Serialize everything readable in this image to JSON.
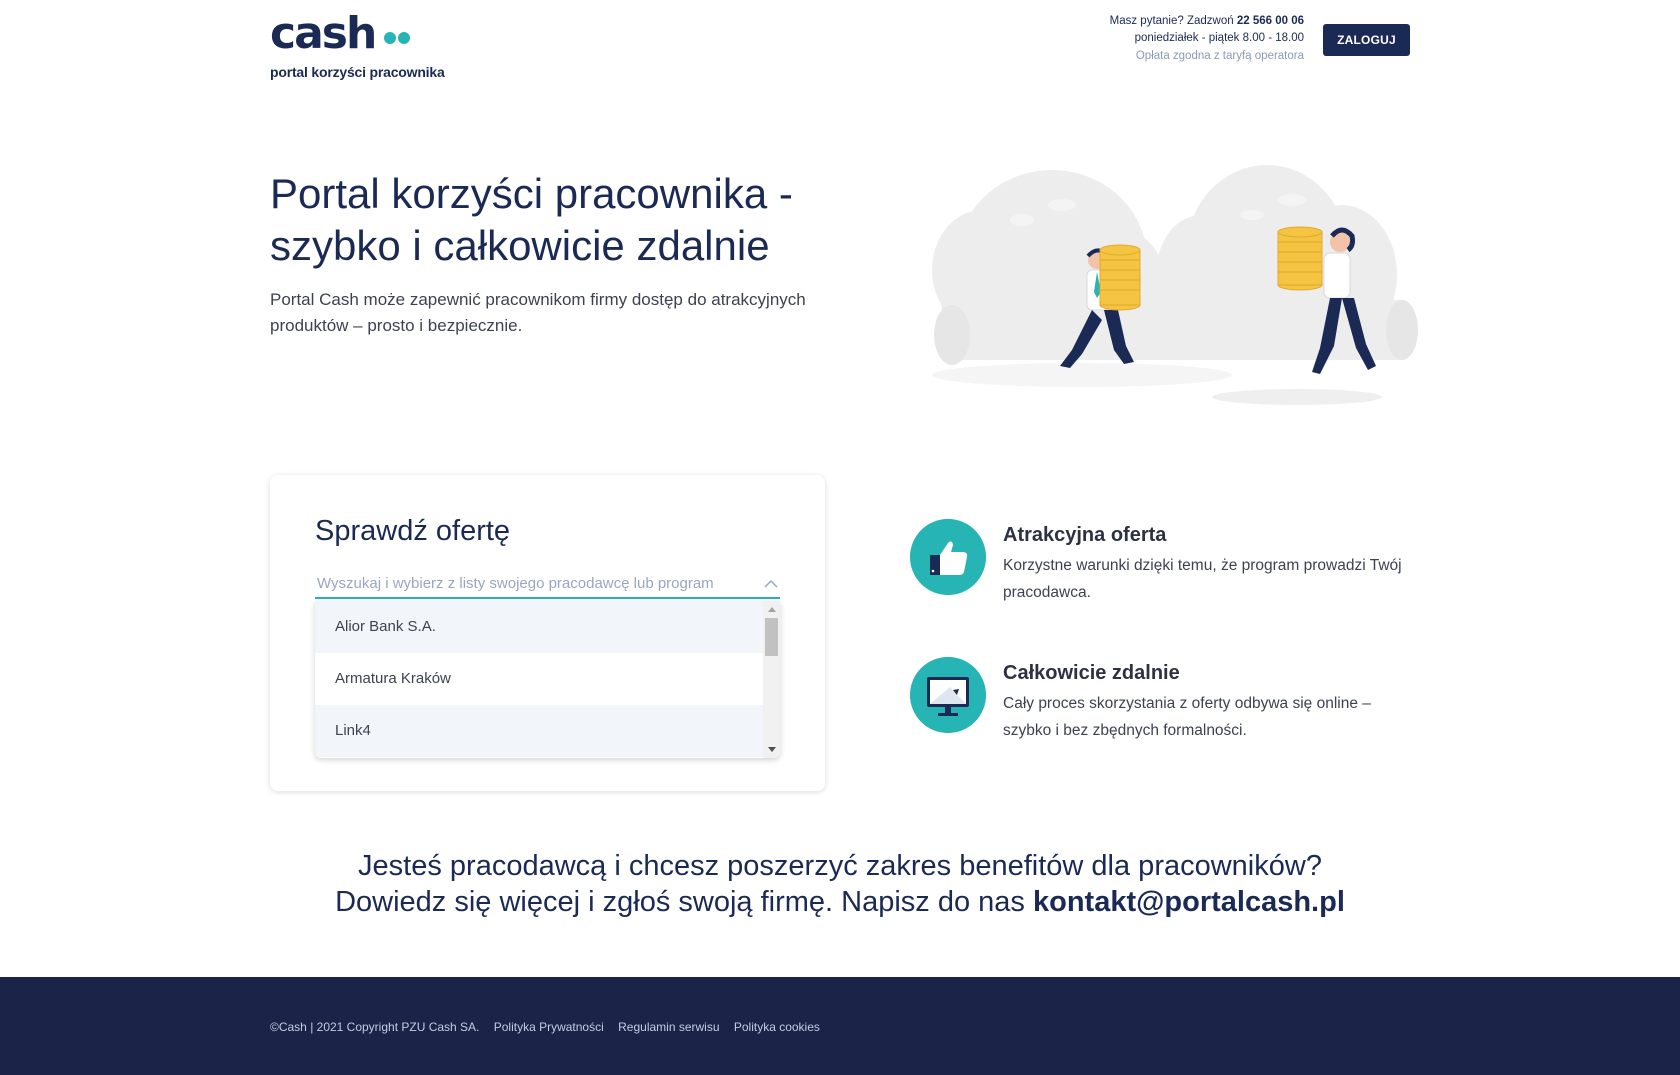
{
  "header": {
    "logo_word": "cash",
    "logo_tagline": "portal korzyści pracownika",
    "contact_question": "Masz pytanie? Zadzwoń",
    "contact_phone": "22 566 00 06",
    "contact_hours": "poniedziałek - piątek 8.00 - 18.00",
    "contact_fee": "Opłata zgodna z taryfą operatora",
    "login_label": "ZALOGUJ"
  },
  "hero": {
    "title_line1": "Portal korzyści pracownika -",
    "title_line2": "szybko i całkowicie zdalnie",
    "text": "Portal Cash może zapewnić pracownikom firmy dostęp do atrakcyjnych produktów – prosto i bezpiecznie."
  },
  "search": {
    "title": "Sprawdź ofertę",
    "placeholder": "Wyszukaj i wybierz z listy swojego pracodawcę lub program",
    "options": [
      "Alior Bank S.A.",
      "Armatura Kraków",
      "Link4"
    ]
  },
  "features": [
    {
      "title": "Atrakcyjna oferta",
      "text": "Korzystne warunki dzięki temu, że program prowadzi Twój pracodawca.",
      "icon": "thumbs-up-icon"
    },
    {
      "title": "Całkowicie zdalnie",
      "text": "Cały proces skorzystania z oferty odbywa się online – szybko i bez zbędnych formalności.",
      "icon": "monitor-icon"
    }
  ],
  "cta": {
    "line1": "Jesteś pracodawcą i chcesz poszerzyć zakres benefitów dla pracowników?",
    "line2_prefix": "Dowiedz się więcej i zgłoś swoją firmę. Napisz do nas",
    "email": "kontakt@portalcash.pl"
  },
  "footer": {
    "copyright": "©Cash | 2021 Copyright PZU Cash SA.",
    "links": [
      "Polityka Prywatności",
      "Regulamin serwisu",
      "Polityka cookies"
    ]
  },
  "colors": {
    "navy": "#1b2a55",
    "teal": "#27b4b4",
    "coin": "#f5c542",
    "footer": "#1b2348"
  }
}
